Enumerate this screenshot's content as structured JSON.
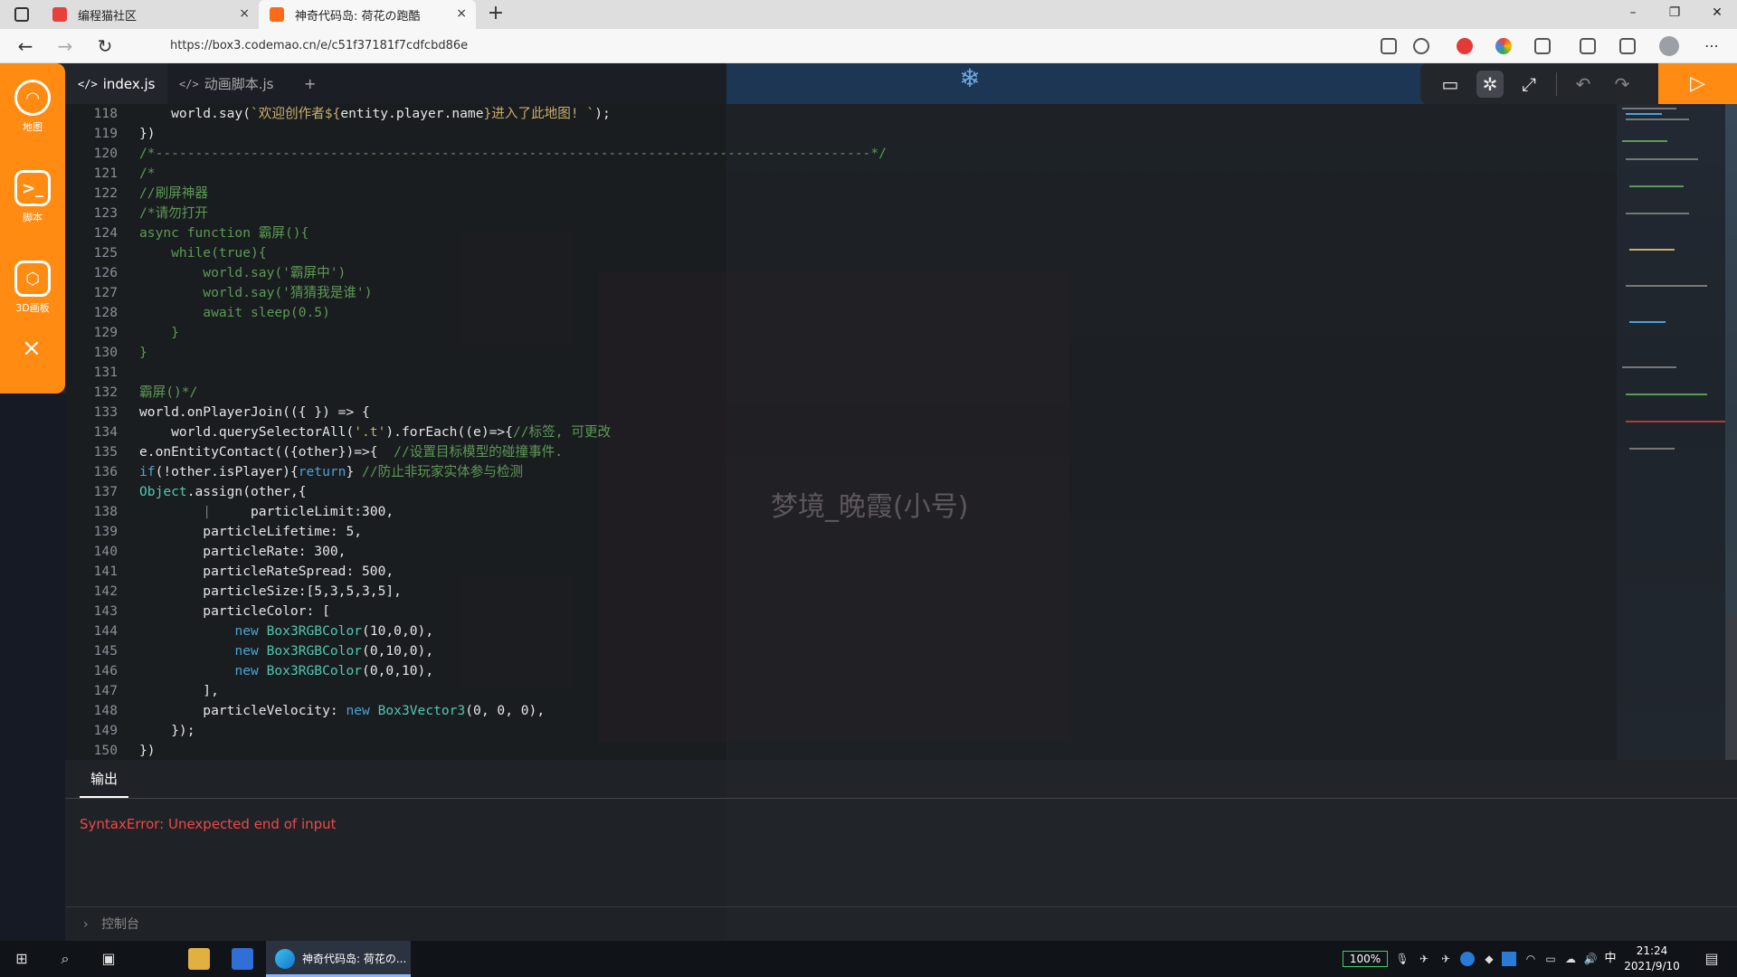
{
  "browser": {
    "tabs": [
      {
        "title": "编程猫社区",
        "close": "×"
      },
      {
        "title": "神奇代码岛: 荷花の跑酷",
        "close": "×"
      }
    ],
    "new_tab": "+",
    "url": "https://box3.codemao.cn/e/c51f37181f7cdfcbd86e",
    "window": {
      "minimize": "–",
      "maximize": "❐",
      "close": "✕"
    }
  },
  "sidebar": {
    "items": [
      {
        "label": "地图",
        "icon": "map-icon"
      },
      {
        "label": "脚本",
        "icon": "script-icon"
      },
      {
        "label": "3D画板",
        "icon": "cube-icon"
      }
    ],
    "close": "×"
  },
  "editor": {
    "tabs": [
      {
        "label": "index.js",
        "icon": "</>"
      },
      {
        "label": "动画脚本.js",
        "icon": "</>"
      }
    ],
    "add_tab": "+"
  },
  "scene": {
    "player_name": "梦境_晚霞(小号)"
  },
  "output": {
    "tab_label": "输出",
    "message": "SyntaxError: Unexpected end of input",
    "console_label": "控制台",
    "console_chevron": "›"
  },
  "taskbar": {
    "active_app": "神奇代码岛: 荷花の...",
    "battery": "100%",
    "ime": "中",
    "time": "21:24",
    "date": "2021/9/10"
  },
  "colors": {
    "accent": "#ff8b12",
    "error": "#f04848"
  }
}
